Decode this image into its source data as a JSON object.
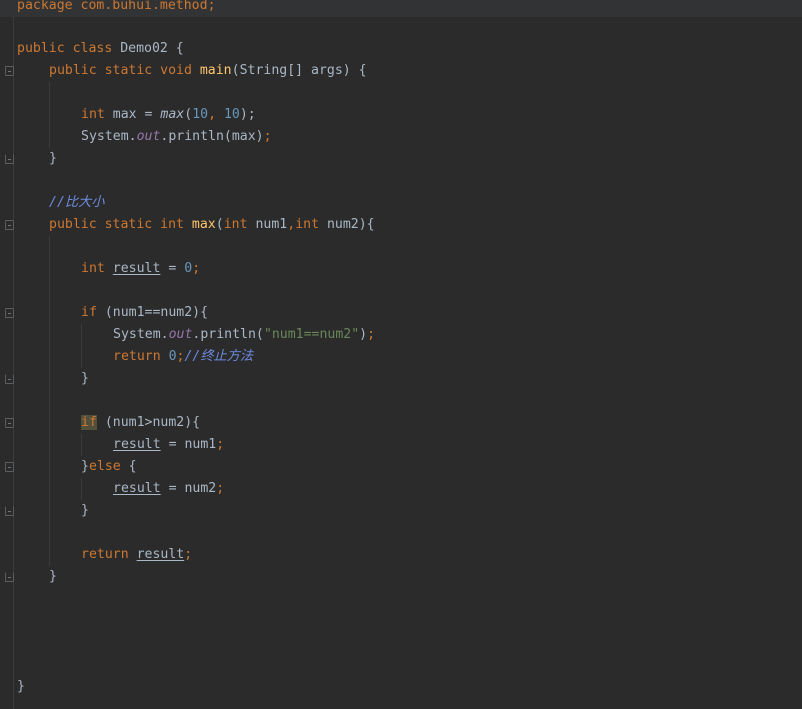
{
  "lines": {
    "l1": {
      "a": "package com.buhui.method",
      "b": ";"
    },
    "l3": {
      "a": "public class ",
      "b": "Demo02 {"
    },
    "l4": {
      "a": "public static void ",
      "b": "main",
      "c": "(String[] args) {"
    },
    "l6": {
      "a": "int ",
      "b": "max = ",
      "c": "max",
      "d": "(",
      "e": "10",
      "f": ", ",
      "g": "10",
      "h": ");"
    },
    "l7": {
      "a": "System.",
      "b": "out",
      "c": ".println(max)",
      "d": ";"
    },
    "l8": {
      "a": "}"
    },
    "l10": {
      "a": "//比大小"
    },
    "l11": {
      "a": "public static int ",
      "b": "max",
      "c": "(",
      "d": "int ",
      "e": "num1",
      "f": ",",
      "g": "int ",
      "h": "num2){"
    },
    "l13": {
      "a": "int ",
      "b": "result",
      "c": " = ",
      "d": "0",
      "e": ";"
    },
    "l15": {
      "a": "if ",
      "b": "(num1==num2){"
    },
    "l16": {
      "a": "System.",
      "b": "out",
      "c": ".println(",
      "d": "\"num1==num2\"",
      "e": ")",
      "f": ";"
    },
    "l17": {
      "a": "return ",
      "b": "0",
      "c": ";",
      "d": "//终止方法"
    },
    "l18": {
      "a": "}"
    },
    "l20": {
      "a": "if",
      "b": " (num1>num2){"
    },
    "l21": {
      "a": "result",
      "b": " = num1",
      "c": ";"
    },
    "l22": {
      "a": "}",
      "b": "else ",
      "c": "{"
    },
    "l23": {
      "a": "result",
      "b": " = num2",
      "c": ";"
    },
    "l24": {
      "a": "}"
    },
    "l26": {
      "a": "return ",
      "b": "result",
      "c": ";"
    },
    "l27": {
      "a": "}"
    },
    "l32": {
      "a": "}"
    }
  },
  "colors": {
    "background": "#2b2b2b",
    "keyword": "#cc7832",
    "method": "#ffc66d",
    "number": "#6897bb",
    "string": "#6a8759",
    "field": "#9876aa",
    "comment": "#6d8be0",
    "default_text": "#a9b7c6"
  },
  "icons": [
    "fold-icon"
  ]
}
